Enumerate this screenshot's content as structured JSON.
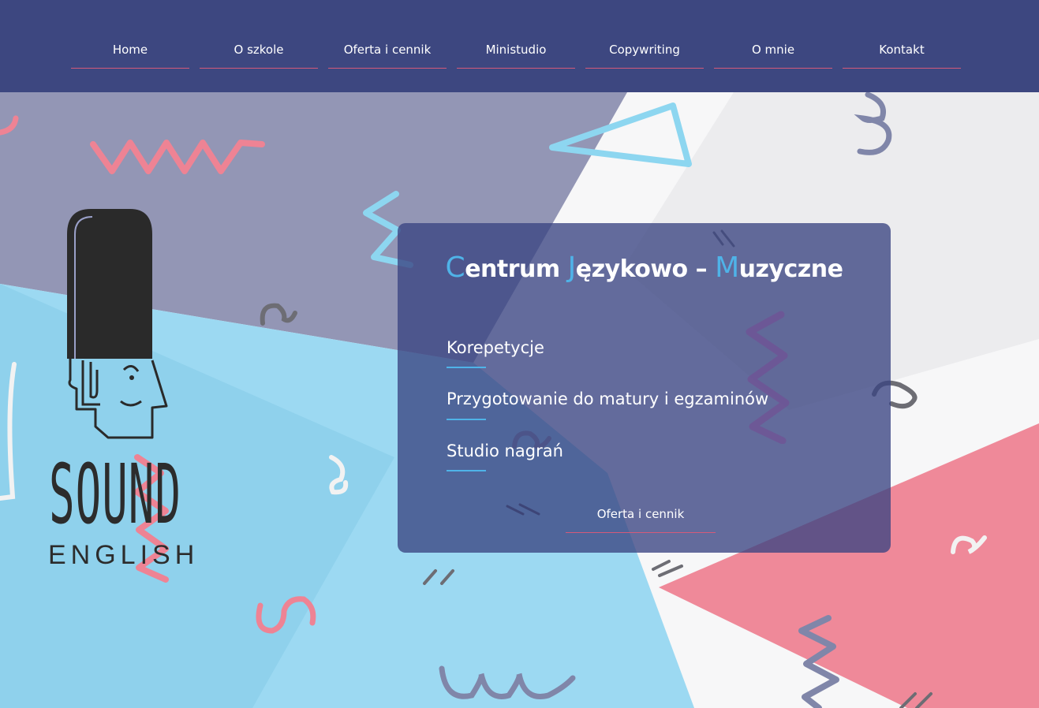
{
  "nav": {
    "items": [
      {
        "label": "Home"
      },
      {
        "label": "O szkole"
      },
      {
        "label": "Oferta i cennik"
      },
      {
        "label": "Ministudio"
      },
      {
        "label": "Copywriting"
      },
      {
        "label": "O mnie"
      },
      {
        "label": "Kontakt"
      }
    ]
  },
  "logo": {
    "word1": "SOUND",
    "word2": "ENGLISH"
  },
  "card": {
    "title": {
      "c1": "C",
      "w1": "entrum ",
      "c2": "J",
      "w2": "ęzykowo – ",
      "c3": "M",
      "w3": "uzyczne"
    },
    "services": [
      {
        "label": "Korepetycje"
      },
      {
        "label": "Przygotowanie do matury i egzaminów"
      },
      {
        "label": "Studio nagrań"
      }
    ],
    "button_label": "Oferta i cennik"
  },
  "colors": {
    "header_bg": "#3d4780",
    "accent_blue": "#4fb3e8",
    "accent_pink": "#d45a7a"
  }
}
